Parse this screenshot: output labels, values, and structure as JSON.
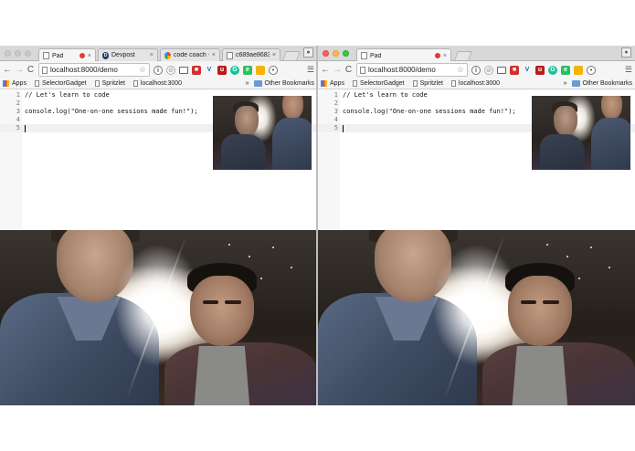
{
  "windows": [
    {
      "id": "left",
      "traffic_lights": "inactive",
      "tabs": [
        {
          "label": "Pad",
          "favicon": "page-icon",
          "recording": true,
          "active": true
        },
        {
          "label": "Devpost",
          "favicon": "devpost-icon",
          "recording": false,
          "active": false
        },
        {
          "label": "code coach -",
          "favicon": "google-icon",
          "recording": false,
          "active": false
        },
        {
          "label": "c689ae8683...",
          "favicon": "page-icon",
          "recording": false,
          "active": false
        }
      ],
      "url": "localhost:8000/demo"
    },
    {
      "id": "right",
      "traffic_lights": "active",
      "tabs": [
        {
          "label": "Pad",
          "favicon": "page-icon",
          "recording": true,
          "active": true
        }
      ],
      "url": "localhost:8000/demo"
    }
  ],
  "tab_close_glyph": "×",
  "nav": {
    "back": "←",
    "forward": "→",
    "reload": "C"
  },
  "bookmarks": {
    "items": [
      {
        "label": "Apps",
        "icon": "apps-grid-icon"
      },
      {
        "label": "SelectorGadget",
        "icon": "page-icon"
      },
      {
        "label": "Spritzlet",
        "icon": "page-icon"
      },
      {
        "label": "localhost:3000",
        "icon": "page-icon"
      }
    ],
    "overflow": "»",
    "other": "Other Bookmarks"
  },
  "extensions": [
    {
      "name": "info-icon",
      "color": "#555555"
    },
    {
      "name": "block-icon",
      "color": "#999999"
    },
    {
      "name": "cast-icon",
      "color": "#555555"
    },
    {
      "name": "adblock-icon",
      "color": "#d32f2f"
    },
    {
      "name": "vimium-icon",
      "color": "#1565c0"
    },
    {
      "name": "ublock-icon",
      "color": "#b71c1c"
    },
    {
      "name": "grammarly-icon",
      "color": "#15c39a"
    },
    {
      "name": "evernote-icon",
      "color": "#2dbe60"
    },
    {
      "name": "screenshot-icon",
      "color": "#f4b400"
    },
    {
      "name": "record-icon",
      "color": "#777777"
    }
  ],
  "editor": {
    "lines": [
      {
        "num": "1",
        "text": "// Let's learn to code"
      },
      {
        "num": "2",
        "text": ""
      },
      {
        "num": "3",
        "text": "console.log(\"One-on-one sessions made fun!\");"
      },
      {
        "num": "4",
        "text": ""
      },
      {
        "num": "5",
        "text": ""
      }
    ],
    "active_line": "5"
  },
  "colors": {
    "close_red": "#fc605b",
    "minimize_yellow": "#fdbc40",
    "zoom_green": "#34c84a",
    "record_red": "#e53935"
  }
}
